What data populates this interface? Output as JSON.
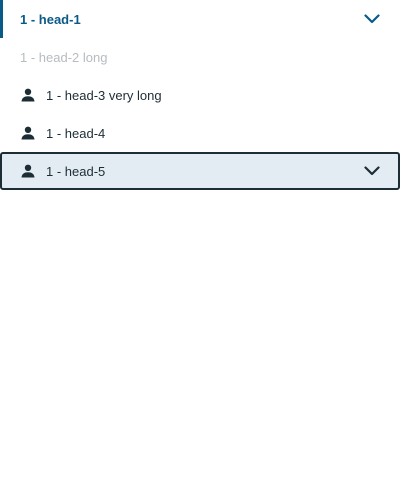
{
  "nav": {
    "items": [
      {
        "label": "1 - head-1",
        "state": "selected",
        "has_chevron": true,
        "icon": "none"
      },
      {
        "label": "1 - head-2 long",
        "state": "disabled",
        "has_chevron": false,
        "icon": "none"
      },
      {
        "label": "1 - head-3 very long",
        "state": "default",
        "has_chevron": false,
        "icon": "person-icon"
      },
      {
        "label": "1 - head-4",
        "state": "default",
        "has_chevron": false,
        "icon": "person-icon"
      },
      {
        "label": "1 - head-5",
        "state": "focused",
        "has_chevron": true,
        "icon": "person-icon"
      }
    ]
  },
  "colors": {
    "accent": "#0a5a87",
    "text": "#1d2d35",
    "disabled": "#b6bcc0",
    "focused_bg": "#e3ecf3"
  }
}
